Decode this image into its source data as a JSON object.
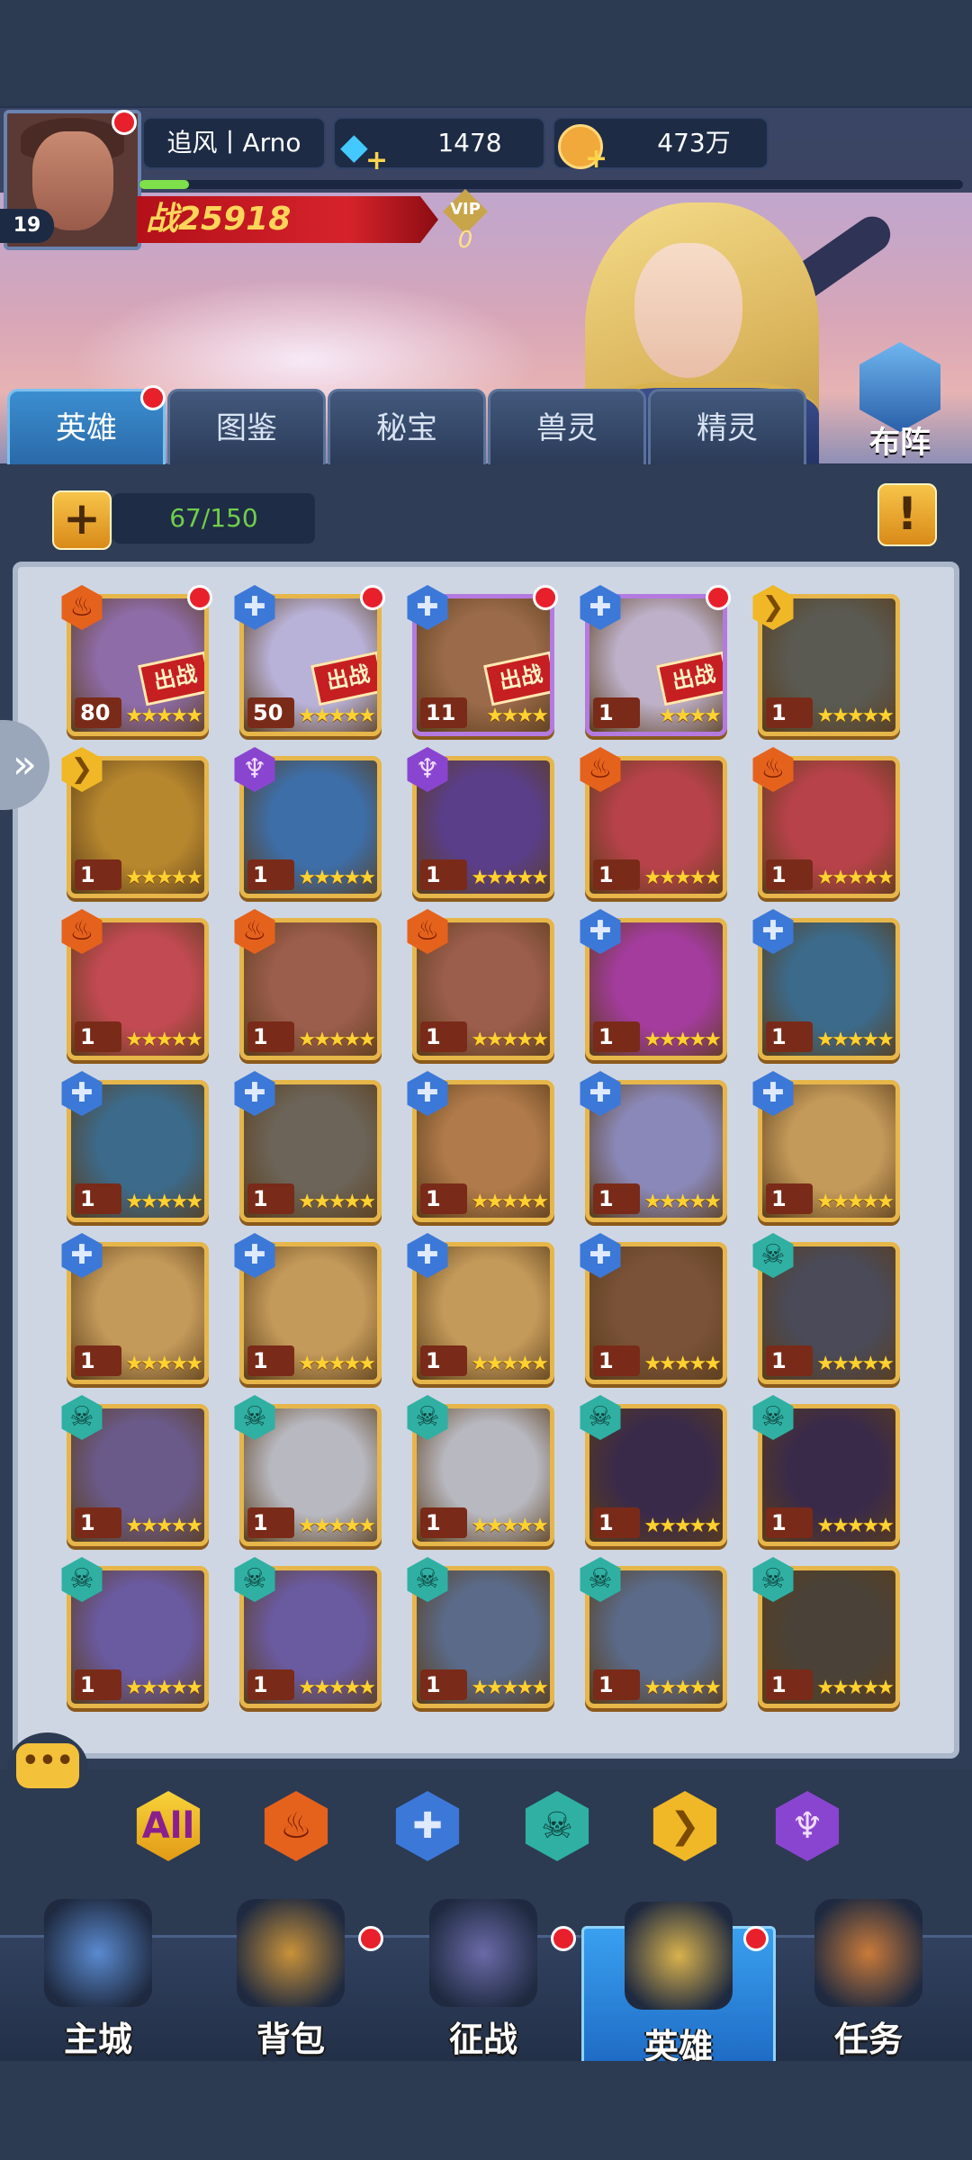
{
  "header": {
    "player_name": "追风丨Arno",
    "level": "19",
    "diamonds": "1478",
    "gold": "473万",
    "xp_fraction": 0.06,
    "power_label": "战25918",
    "vip_label": "VIP",
    "vip_level": "0"
  },
  "tabs": [
    {
      "label": "英雄",
      "active": true
    },
    {
      "label": "图鉴"
    },
    {
      "label": "秘宝"
    },
    {
      "label": "兽灵"
    },
    {
      "label": "精灵"
    }
  ],
  "formation_label": "布阵",
  "capacity": "67/150",
  "deploy_tag": "出战",
  "heroes": [
    {
      "faction": "fire",
      "level": "80",
      "stars": 5,
      "deployed": true,
      "reddot": true,
      "art": "#8e6ca8"
    },
    {
      "faction": "water",
      "level": "50",
      "stars": 5,
      "deployed": true,
      "reddot": true,
      "art": "#b9b2d8"
    },
    {
      "faction": "water",
      "level": "11",
      "stars": 4,
      "deployed": true,
      "reddot": true,
      "art": "#9a6a4a"
    },
    {
      "faction": "water",
      "level": "1",
      "stars": 4,
      "deployed": true,
      "reddot": true,
      "art": "#bdb0c8"
    },
    {
      "faction": "light",
      "level": "1",
      "stars": 5,
      "art": "#5a5a52"
    },
    {
      "faction": "light",
      "level": "1",
      "stars": 5,
      "art": "#b7872e"
    },
    {
      "faction": "dark",
      "level": "1",
      "stars": 5,
      "art": "#3d6ea8"
    },
    {
      "faction": "dark",
      "level": "1",
      "stars": 5,
      "art": "#5a3e8a"
    },
    {
      "faction": "fire",
      "level": "1",
      "stars": 5,
      "art": "#b8424a"
    },
    {
      "faction": "fire",
      "level": "1",
      "stars": 5,
      "art": "#b8424a"
    },
    {
      "faction": "fire",
      "level": "1",
      "stars": 5,
      "art": "#c24a52"
    },
    {
      "faction": "fire",
      "level": "1",
      "stars": 5,
      "art": "#9b5d4c"
    },
    {
      "faction": "fire",
      "level": "1",
      "stars": 5,
      "art": "#9b5d4c"
    },
    {
      "faction": "water",
      "level": "1",
      "stars": 5,
      "art": "#a43c9e"
    },
    {
      "faction": "water",
      "level": "1",
      "stars": 5,
      "art": "#3c6a8a"
    },
    {
      "faction": "water",
      "level": "1",
      "stars": 5,
      "art": "#3c6a8a"
    },
    {
      "faction": "water",
      "level": "1",
      "stars": 5,
      "art": "#6c6458"
    },
    {
      "faction": "water",
      "level": "1",
      "stars": 5,
      "art": "#b07a4a"
    },
    {
      "faction": "water",
      "level": "1",
      "stars": 5,
      "art": "#8a88b8"
    },
    {
      "faction": "water",
      "level": "1",
      "stars": 5,
      "art": "#c49a5a"
    },
    {
      "faction": "water",
      "level": "1",
      "stars": 5,
      "art": "#c49a5a"
    },
    {
      "faction": "water",
      "level": "1",
      "stars": 5,
      "art": "#c49a5a"
    },
    {
      "faction": "water",
      "level": "1",
      "stars": 5,
      "art": "#c49a5a"
    },
    {
      "faction": "water",
      "level": "1",
      "stars": 5,
      "art": "#7a5238"
    },
    {
      "faction": "skull",
      "level": "1",
      "stars": 5,
      "art": "#4a4a58"
    },
    {
      "faction": "skull",
      "level": "1",
      "stars": 5,
      "art": "#6a5a8a"
    },
    {
      "faction": "skull",
      "level": "1",
      "stars": 5,
      "art": "#b8b8c0"
    },
    {
      "faction": "skull",
      "level": "1",
      "stars": 5,
      "art": "#b8b8c0"
    },
    {
      "faction": "skull",
      "level": "1",
      "stars": 5,
      "art": "#3a2a4a"
    },
    {
      "faction": "skull",
      "level": "1",
      "stars": 5,
      "art": "#3a2a4a"
    },
    {
      "faction": "skull",
      "level": "1",
      "stars": 5,
      "art": "#6a5aa0"
    },
    {
      "faction": "skull",
      "level": "1",
      "stars": 5,
      "art": "#6a5aa0"
    },
    {
      "faction": "skull",
      "level": "1",
      "stars": 5,
      "art": "#5a6a88"
    },
    {
      "faction": "skull",
      "level": "1",
      "stars": 5,
      "art": "#5a6a88"
    },
    {
      "faction": "skull",
      "level": "1",
      "stars": 5,
      "art": "#4a4238"
    }
  ],
  "filters": [
    {
      "label": "All",
      "type": "all"
    },
    {
      "type": "fire"
    },
    {
      "type": "water"
    },
    {
      "type": "skull"
    },
    {
      "type": "light"
    },
    {
      "type": "dark"
    }
  ],
  "nav": [
    {
      "label": "主城"
    },
    {
      "label": "背包",
      "reddot": true
    },
    {
      "label": "征战",
      "reddot": true
    },
    {
      "label": "英雄",
      "active": true,
      "reddot": true
    },
    {
      "label": "任务"
    }
  ]
}
